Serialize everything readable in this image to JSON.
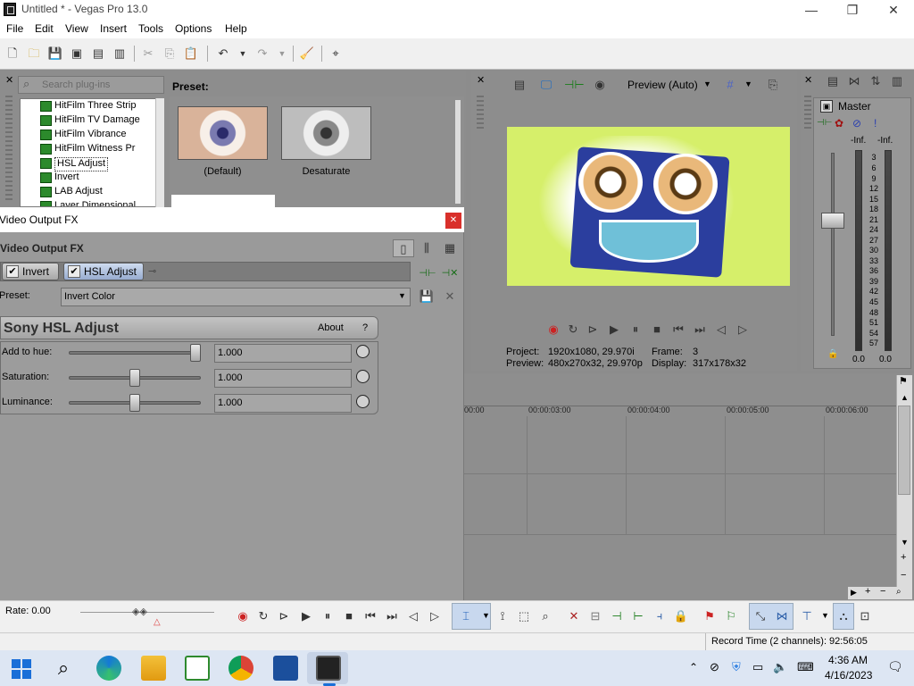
{
  "window": {
    "title": "Untitled * - Vegas Pro 13.0",
    "min": "—",
    "max": "❐",
    "close": "✕"
  },
  "menu": [
    "File",
    "Edit",
    "View",
    "Insert",
    "Tools",
    "Options",
    "Help"
  ],
  "plugins": {
    "search_placeholder": "Search plug-ins",
    "items": [
      "HitFilm Three Strip",
      "HitFilm TV Damage",
      "HitFilm Vibrance",
      "HitFilm Witness Pr",
      "HSL Adjust",
      "Invert",
      "LAB Adjust",
      "Layer Dimensional"
    ],
    "selected": "HSL Adjust",
    "preset_label": "Preset:",
    "presets": [
      "(Default)",
      "Desaturate"
    ]
  },
  "preview": {
    "mode": "Preview (Auto)",
    "project_label": "Project:",
    "project_value": "1920x1080, 29.970i",
    "preview_label": "Preview:",
    "preview_value": "480x270x32, 29.970p",
    "frame_label": "Frame:",
    "frame_value": "3",
    "display_label": "Display:",
    "display_value": "317x178x32"
  },
  "mixer": {
    "label": "Master",
    "left_peak": "-Inf.",
    "right_peak": "-Inf.",
    "scale": [
      "3",
      "6",
      "9",
      "12",
      "15",
      "18",
      "21",
      "24",
      "27",
      "30",
      "33",
      "36",
      "39",
      "42",
      "45",
      "48",
      "51",
      "54",
      "57"
    ],
    "left_level": "0.0",
    "right_level": "0.0"
  },
  "dialog": {
    "window_title": "Video Output FX",
    "header": "Video Output FX",
    "close": "✕",
    "chain": [
      "Invert",
      "HSL Adjust"
    ],
    "preset_label": "Preset:",
    "preset_value": "Invert Color",
    "plugin_name": "Sony HSL Adjust",
    "about": "About",
    "help": "?",
    "params": [
      {
        "label": "Add to hue:",
        "value": "1.000",
        "fraction": 1.0
      },
      {
        "label": "Saturation:",
        "value": "1.000",
        "fraction": 0.5
      },
      {
        "label": "Luminance:",
        "value": "1.000",
        "fraction": 0.5
      }
    ]
  },
  "timeline": {
    "ticks": [
      "00:00",
      "00:00:03:00",
      "00:00:04:00",
      "00:00:05:00",
      "00:00:06:00"
    ],
    "rate_label": "Rate: 0.00"
  },
  "status": {
    "record_time": "Record Time (2 channels): 92:56:05"
  },
  "taskbar": {
    "time": "4:36 AM",
    "date": "4/16/2023"
  },
  "colors": {
    "accent": "#2d6fc5",
    "panel": "#8d8d8d",
    "preview_bg": "#d6ef6a"
  }
}
